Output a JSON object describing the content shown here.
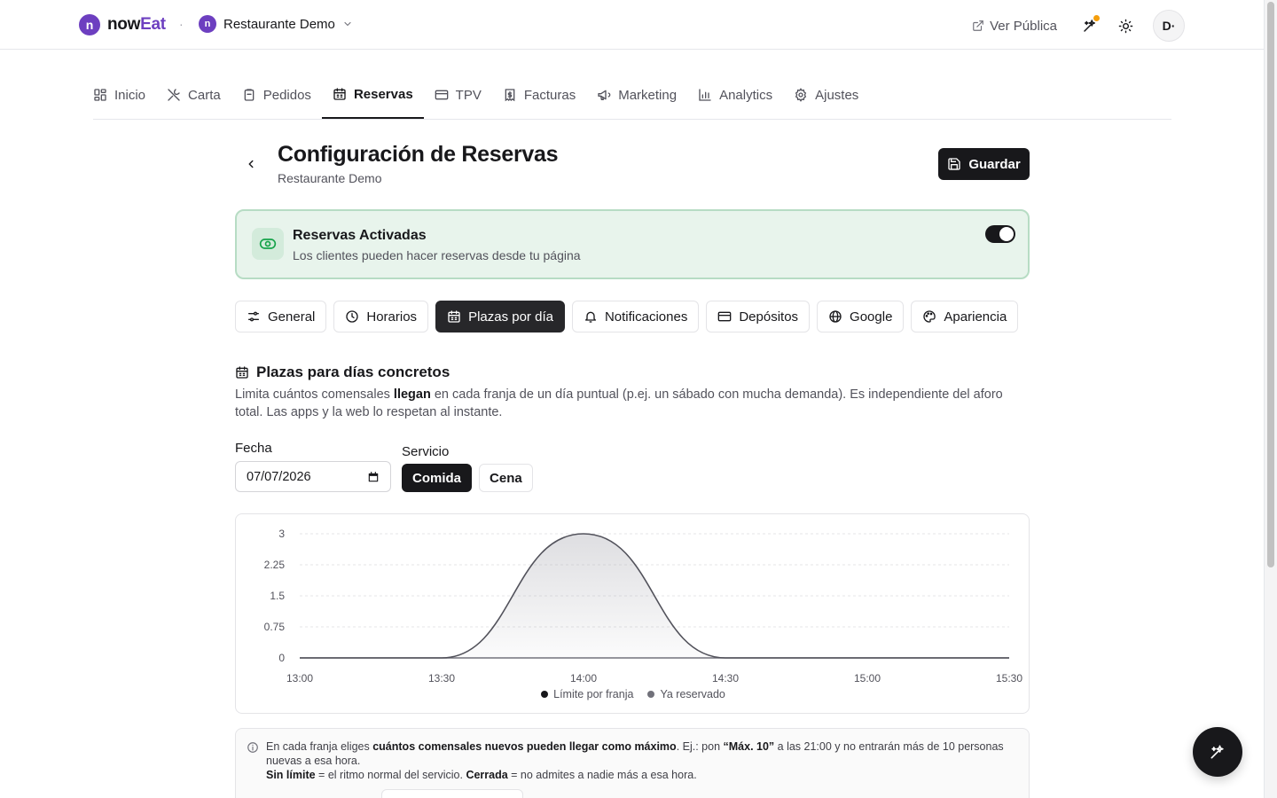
{
  "colors": {
    "brand": "#6d3fc0",
    "active_green_bg": "#e8f4ec",
    "active_green_border": "#b7dcc4",
    "dark": "#18181b",
    "notification": "#f59e0b"
  },
  "header": {
    "logo_letter": "n",
    "brand_now": "now",
    "brand_eat": "Eat",
    "separator": "·",
    "restaurant_letter": "n",
    "restaurant_name": "Restaurante Demo",
    "ver_publica": "Ver Pública",
    "avatar_initials": "D·"
  },
  "nav": {
    "tabs": [
      {
        "label": "Inicio",
        "icon": "grid-icon"
      },
      {
        "label": "Carta",
        "icon": "utensils-icon"
      },
      {
        "label": "Pedidos",
        "icon": "clipboard-icon"
      },
      {
        "label": "Reservas",
        "icon": "calendar-icon",
        "active": true
      },
      {
        "label": "TPV",
        "icon": "credit-card-icon"
      },
      {
        "label": "Facturas",
        "icon": "receipt-icon"
      },
      {
        "label": "Marketing",
        "icon": "megaphone-icon"
      },
      {
        "label": "Analytics",
        "icon": "bar-chart-icon"
      },
      {
        "label": "Ajustes",
        "icon": "gear-icon"
      }
    ]
  },
  "page": {
    "title": "Configuración de Reservas",
    "subtitle": "Restaurante Demo",
    "save_label": "Guardar"
  },
  "reservations_card": {
    "title": "Reservas Activadas",
    "description": "Los clientes pueden hacer reservas desde tu página",
    "enabled": true
  },
  "subtabs": [
    {
      "label": "General",
      "icon": "sliders-icon"
    },
    {
      "label": "Horarios",
      "icon": "clock-icon"
    },
    {
      "label": "Plazas por día",
      "icon": "calendar-icon",
      "active": true
    },
    {
      "label": "Notificaciones",
      "icon": "bell-icon"
    },
    {
      "label": "Depósitos",
      "icon": "credit-card-icon"
    },
    {
      "label": "Google",
      "icon": "globe-icon"
    },
    {
      "label": "Apariencia",
      "icon": "palette-icon"
    }
  ],
  "section": {
    "title": "Plazas para días concretos",
    "desc_before": "Limita cuántos comensales ",
    "desc_bold": "llegan",
    "desc_after": " en cada franja de un día puntual (p.ej. un sábado con mucha demanda). Es independiente del aforo total. Las apps y la web lo respetan al instante."
  },
  "form": {
    "date_label": "Fecha",
    "date_value": "07/07/2026",
    "service_label": "Servicio",
    "services": [
      {
        "label": "Comida",
        "active": true
      },
      {
        "label": "Cena",
        "active": false
      }
    ]
  },
  "chart_data": {
    "type": "area",
    "x": [
      "13:00",
      "13:30",
      "14:00",
      "14:30",
      "15:00",
      "15:30"
    ],
    "yticks": [
      "0",
      "0.75",
      "1.5",
      "2.25",
      "3"
    ],
    "ylim": [
      0,
      3
    ],
    "grid": true,
    "legend_position": "bottom",
    "series": [
      {
        "name": "Límite por franja",
        "values": [
          0,
          0,
          3,
          0,
          0,
          0
        ],
        "color": "#18181b"
      },
      {
        "name": "Ya reservado",
        "values": [
          0,
          0,
          0,
          0,
          0,
          0
        ],
        "color": "#71717a"
      }
    ]
  },
  "info": {
    "p1_a": "En cada franja eliges ",
    "p1_b": "cuántos comensales nuevos pueden llegar como máximo",
    "p1_c": ". Ej.: pon ",
    "p1_d": "“Máx. 10”",
    "p1_e": " a las 21:00 y no entrarán más de 10 personas nuevas a esa hora.",
    "p2_a": "Sin límite",
    "p2_b": " = el ritmo normal del servicio. ",
    "p2_c": "Cerrada",
    "p2_d": " = no admites a nadie más a esa hora."
  }
}
